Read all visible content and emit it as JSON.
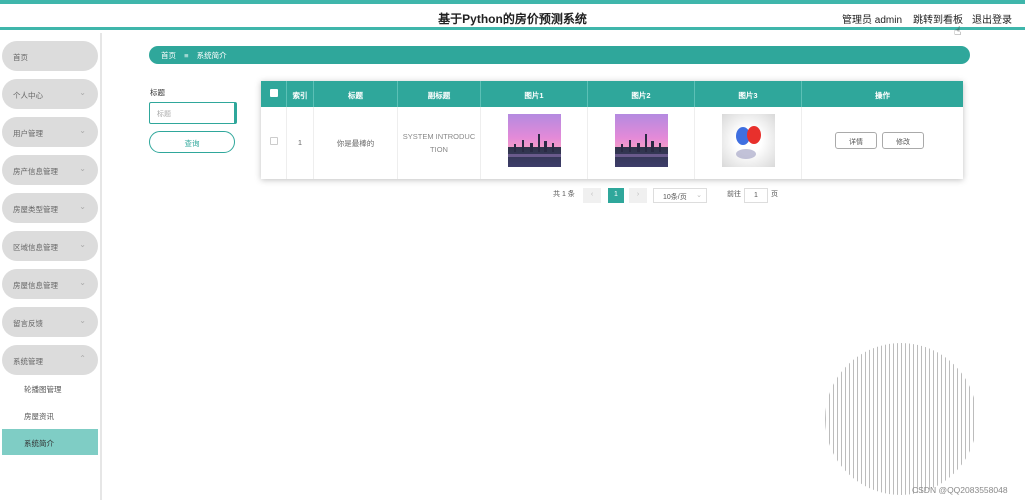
{
  "header": {
    "title": "基于Python的房价预测系统",
    "admin": "管理员 admin",
    "dashboard_link": "跳转到看板",
    "logout": "退出登录"
  },
  "sidebar": {
    "items": [
      {
        "label": "首页"
      },
      {
        "label": "个人中心"
      },
      {
        "label": "用户管理"
      },
      {
        "label": "房产信息管理"
      },
      {
        "label": "房屋类型管理"
      },
      {
        "label": "区域信息管理"
      },
      {
        "label": "房屋信息管理"
      },
      {
        "label": "留言反馈"
      },
      {
        "label": "系统管理"
      }
    ],
    "subitems": [
      {
        "label": "轮播图管理"
      },
      {
        "label": "房屋资讯"
      },
      {
        "label": "系统简介"
      }
    ]
  },
  "breadcrumb": {
    "home": "首页",
    "separator": "≡",
    "current": "系统简介"
  },
  "search": {
    "label": "标题",
    "placeholder": "标题",
    "button": "查询"
  },
  "table": {
    "headers": [
      "索引",
      "标题",
      "副标题",
      "图片1",
      "图片2",
      "图片3",
      "操作"
    ],
    "rows": [
      {
        "index": "1",
        "title": "你是最棒的",
        "subtitle_line1": "SYSTEM INTRODUC",
        "subtitle_line2": "TION",
        "detail": "详情",
        "edit": "修改"
      }
    ]
  },
  "pagination": {
    "total": "共 1 条",
    "prev": "‹",
    "page": "1",
    "next": "›",
    "page_size": "10条/页",
    "goto_label": "前往",
    "goto_value": "1",
    "page_unit": "页"
  },
  "watermark": "CSDN @QQ2083558048",
  "colors": {
    "accent": "#2fa79b",
    "active_menu": "#7fcdc5",
    "menu_bg": "#dcdcdc"
  }
}
